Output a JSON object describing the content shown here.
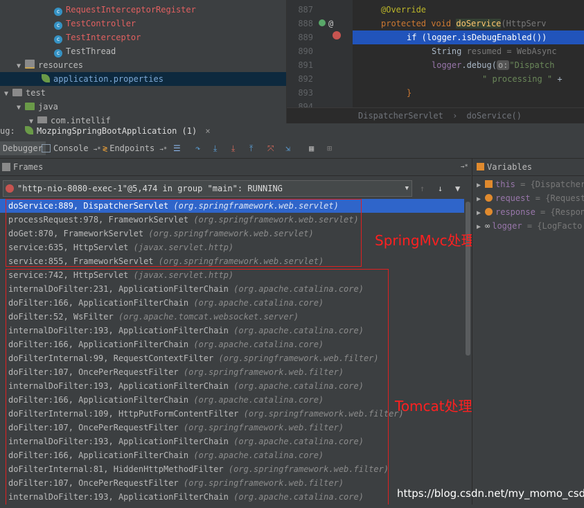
{
  "tree": {
    "items": [
      {
        "label": "RequestInterceptorRegister",
        "kind": "class",
        "color": "red"
      },
      {
        "label": "TestController",
        "kind": "class",
        "color": "red"
      },
      {
        "label": "TestInterceptor",
        "kind": "class",
        "color": "red"
      },
      {
        "label": "TestThread",
        "kind": "class",
        "color": "plain"
      },
      {
        "label": "resources",
        "kind": "folder"
      },
      {
        "label": "application.properties",
        "kind": "file",
        "color": "blue"
      },
      {
        "label": "test",
        "kind": "folder"
      },
      {
        "label": "java",
        "kind": "folder"
      },
      {
        "label": "com.intellif",
        "kind": "package"
      }
    ]
  },
  "editor": {
    "line_numbers": [
      "887",
      "888",
      "889",
      "890",
      "891",
      "892",
      "893",
      "894"
    ],
    "lines": {
      "l887": "@Override",
      "l888_kw": "protected void ",
      "l888_m": "doService",
      "l888_p": "(HttpServ",
      "l889": "if (logger.isDebugEnabled())",
      "l890_t": "String ",
      "l890_v": "resumed",
      "l890_r": " = WebAsync",
      "l891_a": "logger",
      "l891_b": ".debug(",
      "l891_c": "o:",
      "l891_d": "\"Dispatch",
      "l892_a": "\" processing \"",
      "l892_b": " + ",
      "l893": "}"
    },
    "breadcrumb": [
      "DispatcherServlet",
      "doService()"
    ]
  },
  "tabs": {
    "prefix": "ug:",
    "run_config": "MozpingSpringBootApplication (1)",
    "close": "×"
  },
  "toolbar": {
    "debugger": "Debugger",
    "console": "Console",
    "console_pin": "→*",
    "endpoints": "Endpoints",
    "endpoints_pin": "→*"
  },
  "frames": {
    "title": "Frames",
    "pin": "→*",
    "thread": "\"http-nio-8080-exec-1\"@5,474 in group \"main\": RUNNING",
    "rows": [
      {
        "method": "doService:889, DispatcherServlet ",
        "pkg": "(org.springframework.web.servlet)"
      },
      {
        "method": "processRequest:978, FrameworkServlet ",
        "pkg": "(org.springframework.web.servlet)"
      },
      {
        "method": "doGet:870, FrameworkServlet ",
        "pkg": "(org.springframework.web.servlet)"
      },
      {
        "method": "service:635, HttpServlet ",
        "pkg": "(javax.servlet.http)"
      },
      {
        "method": "service:855, FrameworkServlet ",
        "pkg": "(org.springframework.web.servlet)"
      },
      {
        "method": "service:742, HttpServlet ",
        "pkg": "(javax.servlet.http)"
      },
      {
        "method": "internalDoFilter:231, ApplicationFilterChain ",
        "pkg": "(org.apache.catalina.core)"
      },
      {
        "method": "doFilter:166, ApplicationFilterChain ",
        "pkg": "(org.apache.catalina.core)"
      },
      {
        "method": "doFilter:52, WsFilter ",
        "pkg": "(org.apache.tomcat.websocket.server)"
      },
      {
        "method": "internalDoFilter:193, ApplicationFilterChain ",
        "pkg": "(org.apache.catalina.core)"
      },
      {
        "method": "doFilter:166, ApplicationFilterChain ",
        "pkg": "(org.apache.catalina.core)"
      },
      {
        "method": "doFilterInternal:99, RequestContextFilter ",
        "pkg": "(org.springframework.web.filter)"
      },
      {
        "method": "doFilter:107, OncePerRequestFilter ",
        "pkg": "(org.springframework.web.filter)"
      },
      {
        "method": "internalDoFilter:193, ApplicationFilterChain ",
        "pkg": "(org.apache.catalina.core)"
      },
      {
        "method": "doFilter:166, ApplicationFilterChain ",
        "pkg": "(org.apache.catalina.core)"
      },
      {
        "method": "doFilterInternal:109, HttpPutFormContentFilter ",
        "pkg": "(org.springframework.web.filter)"
      },
      {
        "method": "doFilter:107, OncePerRequestFilter ",
        "pkg": "(org.springframework.web.filter)"
      },
      {
        "method": "internalDoFilter:193, ApplicationFilterChain ",
        "pkg": "(org.apache.catalina.core)"
      },
      {
        "method": "doFilter:166, ApplicationFilterChain ",
        "pkg": "(org.apache.catalina.core)"
      },
      {
        "method": "doFilterInternal:81, HiddenHttpMethodFilter ",
        "pkg": "(org.springframework.web.filter)"
      },
      {
        "method": "doFilter:107, OncePerRequestFilter ",
        "pkg": "(org.springframework.web.filter)"
      },
      {
        "method": "internalDoFilter:193, ApplicationFilterChain ",
        "pkg": "(org.apache.catalina.core)"
      }
    ]
  },
  "annotations": {
    "springmvc": "SpringMvc处理",
    "tomcat": "Tomcat处理",
    "color": "#ff2020"
  },
  "variables": {
    "title": "Variables",
    "rows": [
      {
        "name": "this",
        "value": " = {Dispatcher"
      },
      {
        "name": "request",
        "value": " = {Request"
      },
      {
        "name": "response",
        "value": " = {Respon"
      },
      {
        "name": "logger",
        "value": " = {LogFacto"
      }
    ]
  },
  "watermark": "https://blog.csdn.net/my_momo_csdn",
  "colors": {
    "selection": "#2f65ca",
    "breakpoint_line": "#2154bb",
    "annotation_box": "#e02020"
  }
}
